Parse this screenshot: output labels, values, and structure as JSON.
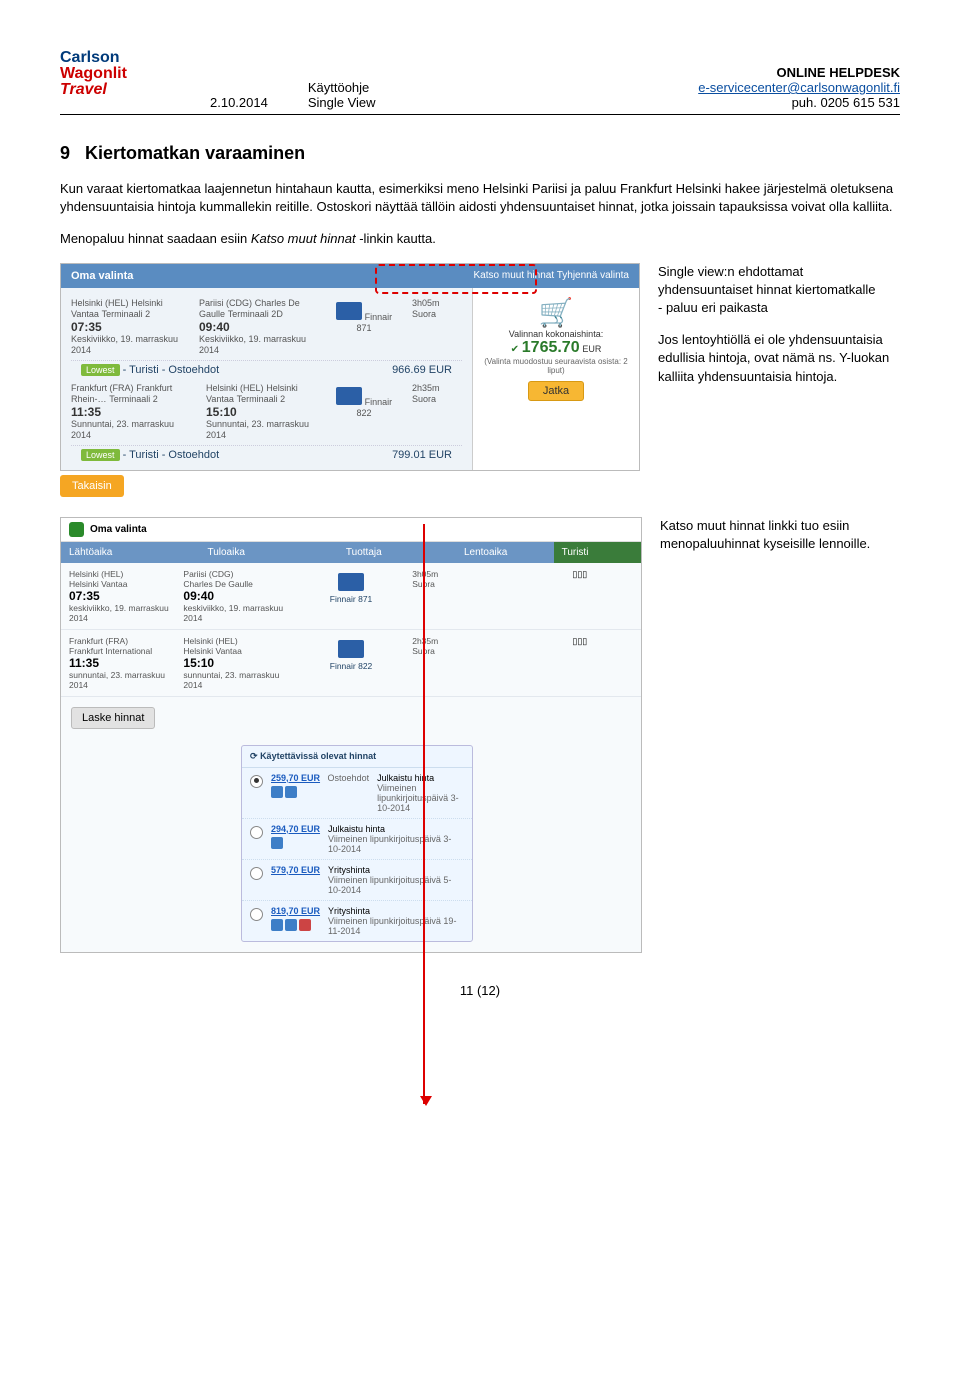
{
  "header": {
    "logo_lines": [
      "Carlson",
      "Wagonlit",
      "Travel"
    ],
    "left_date": "2.10.2014",
    "left_mid": "Käyttöohje",
    "left_bot": "Single View",
    "right_title": "ONLINE HELPDESK",
    "right_email": "e-servicecenter@carlsonwagonlit.fi",
    "right_phone": "puh. 0205 615 531"
  },
  "section": {
    "number": "9",
    "title": "Kiertomatkan varaaminen",
    "para1": "Kun varaat kiertomatkaa laajennetun hintahaun kautta, esimerkiksi meno Helsinki Pariisi ja paluu Frankfurt Helsinki hakee järjestelmä oletuksena yhdensuuntaisia hintoja kummallekin reitille. Ostoskori näyttää tällöin aidosti yhdensuuntaiset hinnat, jotka joissain tapauksissa voivat olla kalliita.",
    "para2_pre": "Menopaluu hinnat saadaan esiin ",
    "para2_em": "Katso muut hinnat",
    "para2_post": " -linkin kautta."
  },
  "shot1": {
    "header_title": "Oma valinta",
    "header_links": "Katso muut hinnat   Tyhjennä valinta",
    "row1": {
      "dep_code": "Helsinki (HEL)",
      "dep_name": "Helsinki Vantaa",
      "dep_term": "Terminaali 2",
      "arr_code": "Pariisi (CDG)",
      "arr_name": "Charles De Gaulle",
      "arr_term": "Terminaali 2D",
      "dep_time": "07:35",
      "arr_time": "09:40",
      "dep_date": "Keskiviikko, 19. marraskuu 2014",
      "arr_date": "Keskiviikko, 19. marraskuu 2014",
      "flight": "Finnair 871",
      "dur": "3h05m",
      "stops": "Suora",
      "tag": "Lowest",
      "class": "- Turisti - Ostoehdot",
      "price": "966.69 EUR"
    },
    "row2": {
      "dep_code": "Frankfurt (FRA)",
      "dep_name": "Frankfurt Rhein-…",
      "dep_term": "Terminaali 2",
      "arr_code": "Helsinki (HEL)",
      "arr_name": "Helsinki Vantaa",
      "arr_term": "Terminaali 2",
      "dep_time": "11:35",
      "arr_time": "15:10",
      "dep_date": "Sunnuntai, 23. marraskuu 2014",
      "arr_date": "Sunnuntai, 23. marraskuu 2014",
      "flight": "Finnair 822",
      "dur": "2h35m",
      "stops": "Suora",
      "tag": "Lowest",
      "class": "- Turisti - Ostoehdot",
      "price": "799.01 EUR"
    },
    "cart": {
      "label": "Valinnan kokonaishinta:",
      "total": "1765.70",
      "cur": "EUR",
      "note": "(Valinta muodostuu seuraavista osista: 2 liput)",
      "btn": "Jatka"
    },
    "back": "Takaisin"
  },
  "right_copy": {
    "p1": "Single view:n ehdottamat yhdensuuntaiset hinnat kiertomatkalle\n- paluu eri paikasta",
    "p2": "Jos lentoyhtiöllä ei ole yhdensuuntaisia edullisia hintoja, ovat nämä ns. Y-luokan kalliita yhdensuuntaisia hintoja.",
    "p3": "Katso muut hinnat linkki tuo esiin menopaluuhinnat kyseisille lennoille."
  },
  "shot2": {
    "oma": "Oma valinta",
    "cols": [
      "Lähtöaika",
      "Tuloaika",
      "Tuottaja",
      "Lentoaika",
      "Turisti"
    ],
    "r1": {
      "dep_code": "Helsinki (HEL)",
      "dep_name": "Helsinki Vantaa",
      "arr_code": "Pariisi (CDG)",
      "arr_name": "Charles De Gaulle",
      "dep_time": "07:35",
      "arr_time": "09:40",
      "dep_date": "keskiviikko, 19. marraskuu 2014",
      "arr_date": "keskiviikko, 19. marraskuu 2014",
      "flight": "Finnair 871",
      "dur": "3h05m",
      "stops": "Suora"
    },
    "r2": {
      "dep_code": "Frankfurt (FRA)",
      "dep_name": "Frankfurt International",
      "arr_code": "Helsinki (HEL)",
      "arr_name": "Helsinki Vantaa",
      "dep_time": "11:35",
      "arr_time": "15:10",
      "dep_date": "sunnuntai, 23. marraskuu 2014",
      "arr_date": "sunnuntai, 23. marraskuu 2014",
      "flight": "Finnair 822",
      "dur": "2h35m",
      "stops": "Suora"
    },
    "laske": "Laske hinnat",
    "pl_title": "Käytettävissä olevat hinnat",
    "prices": [
      {
        "amt": "259,70 EUR",
        "type": "Ostoehdot",
        "line1": "Julkaistu hinta",
        "line2": "Viimeinen lipunkirjoituspäivä 3-10-2014",
        "selected": true,
        "icons": 2
      },
      {
        "amt": "294,70 EUR",
        "type": "",
        "line1": "Julkaistu hinta",
        "line2": "Viimeinen lipunkirjoituspäivä 3-10-2014",
        "selected": false,
        "icons": 1
      },
      {
        "amt": "579,70 EUR",
        "type": "",
        "line1": "Yrityshinta",
        "line2": "Viimeinen lipunkirjoituspäivä 5-10-2014",
        "selected": false,
        "icons": 0
      },
      {
        "amt": "819,70 EUR",
        "type": "",
        "line1": "Yrityshinta",
        "line2": "Viimeinen lipunkirjoituspäivä 19-11-2014",
        "selected": false,
        "icons": 3
      }
    ]
  },
  "footer": "11 (12)"
}
